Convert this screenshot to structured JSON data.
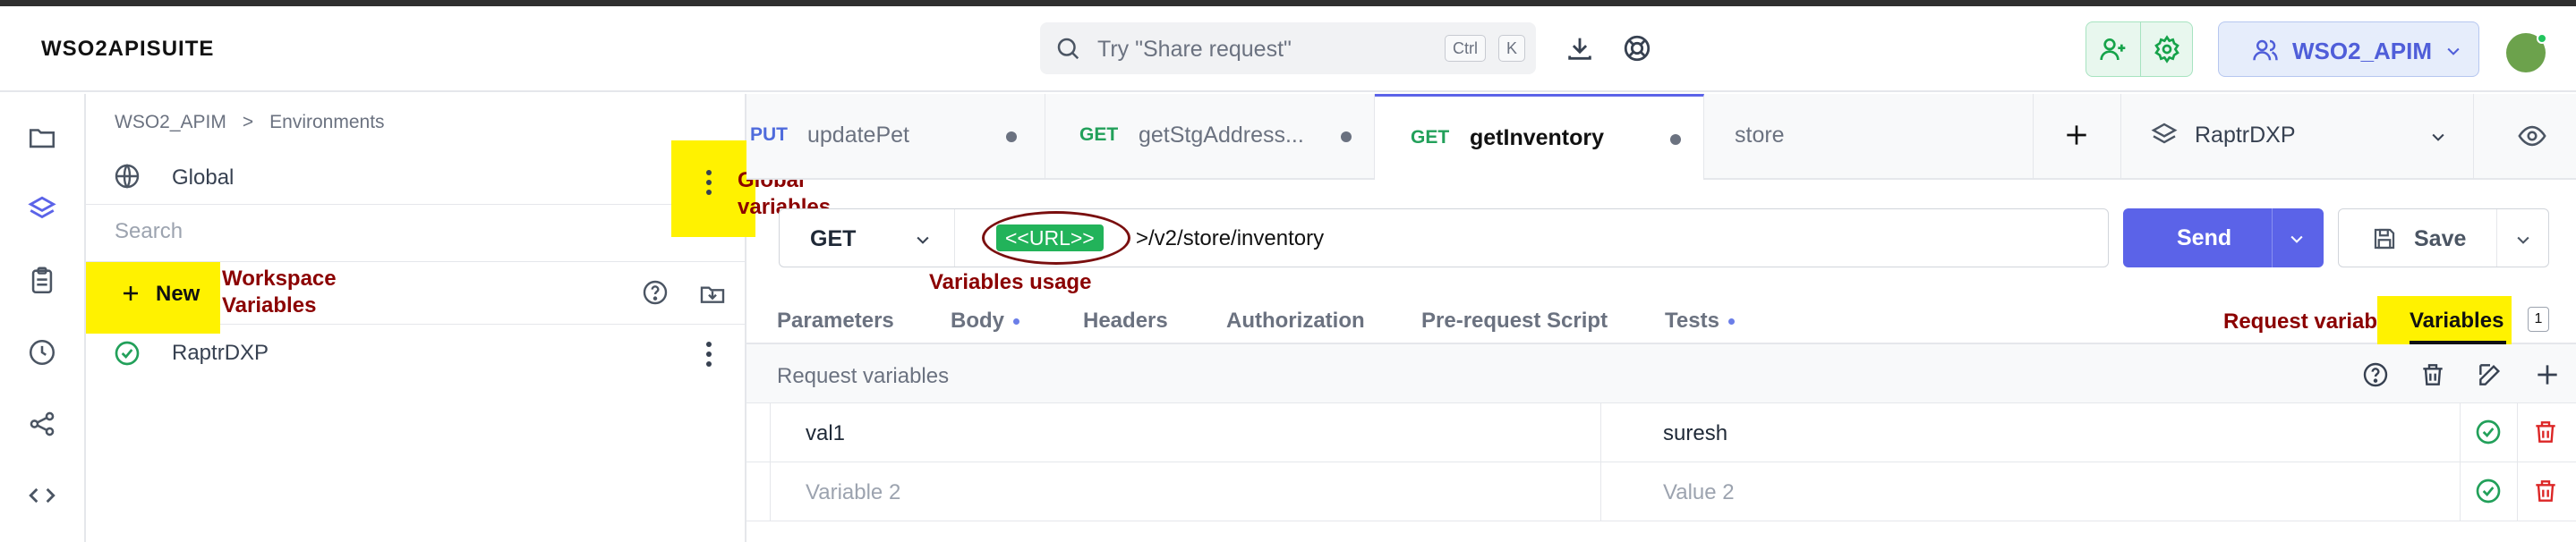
{
  "header": {
    "brand": "WSO2APISUITE",
    "search_placeholder": "Try \"Share request\"",
    "kbd_ctrl": "Ctrl",
    "kbd_k": "K",
    "workspace": "WSO2_APIM"
  },
  "sidebar": {
    "breadcrumb": [
      "WSO2_APIM",
      "Environments"
    ],
    "global_label": "Global",
    "search_placeholder": "Search",
    "new_label": "New",
    "environments": [
      {
        "name": "RaptrDXP"
      }
    ]
  },
  "tabs": [
    {
      "method": "PUT",
      "name": "updatePet",
      "method_color": "#4f6bdc"
    },
    {
      "method": "GET",
      "name": "getStgAddress...",
      "method_color": "#22a05a"
    },
    {
      "method": "GET",
      "name": "getInventory",
      "method_color": "#22a05a",
      "active": true
    },
    {
      "method": "",
      "name": "store"
    }
  ],
  "environment_selector": "RaptrDXP",
  "request": {
    "method": "GET",
    "url_variable": "<<URL>>",
    "url_rest": ">/v2/store/inventory",
    "send_label": "Send",
    "save_label": "Save"
  },
  "subtabs": [
    "Parameters",
    "Body",
    "Headers",
    "Authorization",
    "Pre-request Script",
    "Tests",
    "Variables"
  ],
  "variables_count": "1",
  "variables_section": {
    "title": "Request variables",
    "rows": [
      {
        "key": "val1",
        "value": "suresh"
      },
      {
        "key": "",
        "value": "",
        "key_placeholder": "Variable 2",
        "value_placeholder": "Value 2"
      }
    ]
  },
  "annotations": {
    "global": "Global variables",
    "workspace": "Workspace Variables",
    "usage": "Variables usage",
    "request": "Request variables"
  },
  "colors": {
    "accent": "#5b63e8",
    "get": "#22a05a",
    "put": "#4f6bdc",
    "highlight": "#fff200",
    "annotation": "#8b0000"
  }
}
